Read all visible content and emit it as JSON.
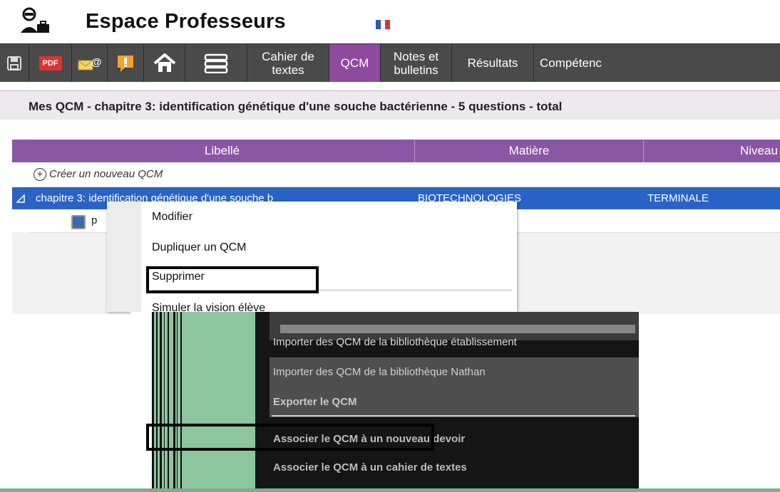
{
  "app": {
    "title": "Espace Professeurs"
  },
  "toolbar": {
    "pdf_label": "PDF",
    "cahier_label": "Cahier de textes",
    "qcm_label": "QCM",
    "notes_label": "Notes et bulletins",
    "resultats_label": "Résultats",
    "competences_label": "Compétenc"
  },
  "breadcrumb": {
    "text": "Mes QCM  - chapitre 3: identification génétique d'une souche bactérienne - 5 questions - total"
  },
  "grid": {
    "columns": [
      "Libellé",
      "Matière",
      "Niveau"
    ],
    "new_row_label": "Créer un nouveau QCM",
    "selected_row": {
      "libelle": "chapitre 3: identification génétique d'une souche b",
      "matiere": "BIOTECHNOLOGIES",
      "niveau": "TERMINALE"
    },
    "sub_row_text": "p"
  },
  "context_menu": {
    "items": [
      "Modifier",
      "Dupliquer un QCM",
      "Supprimer",
      "Simuler la vision élève"
    ]
  },
  "glitch_menu": {
    "items": [
      "Importer des QCM de la bibliothèque établissement",
      "Importer des QCM de la bibliothèque Nathan",
      "Exporter le QCM",
      "Associer le QCM à un nouveau devoir",
      "Associer le QCM à un cahier de textes"
    ]
  },
  "colors": {
    "toolbar_bg": "#4a4a4a",
    "active_tab": "#8e4a9e",
    "grid_header": "#8b56a3",
    "selection": "#2a63c6"
  }
}
